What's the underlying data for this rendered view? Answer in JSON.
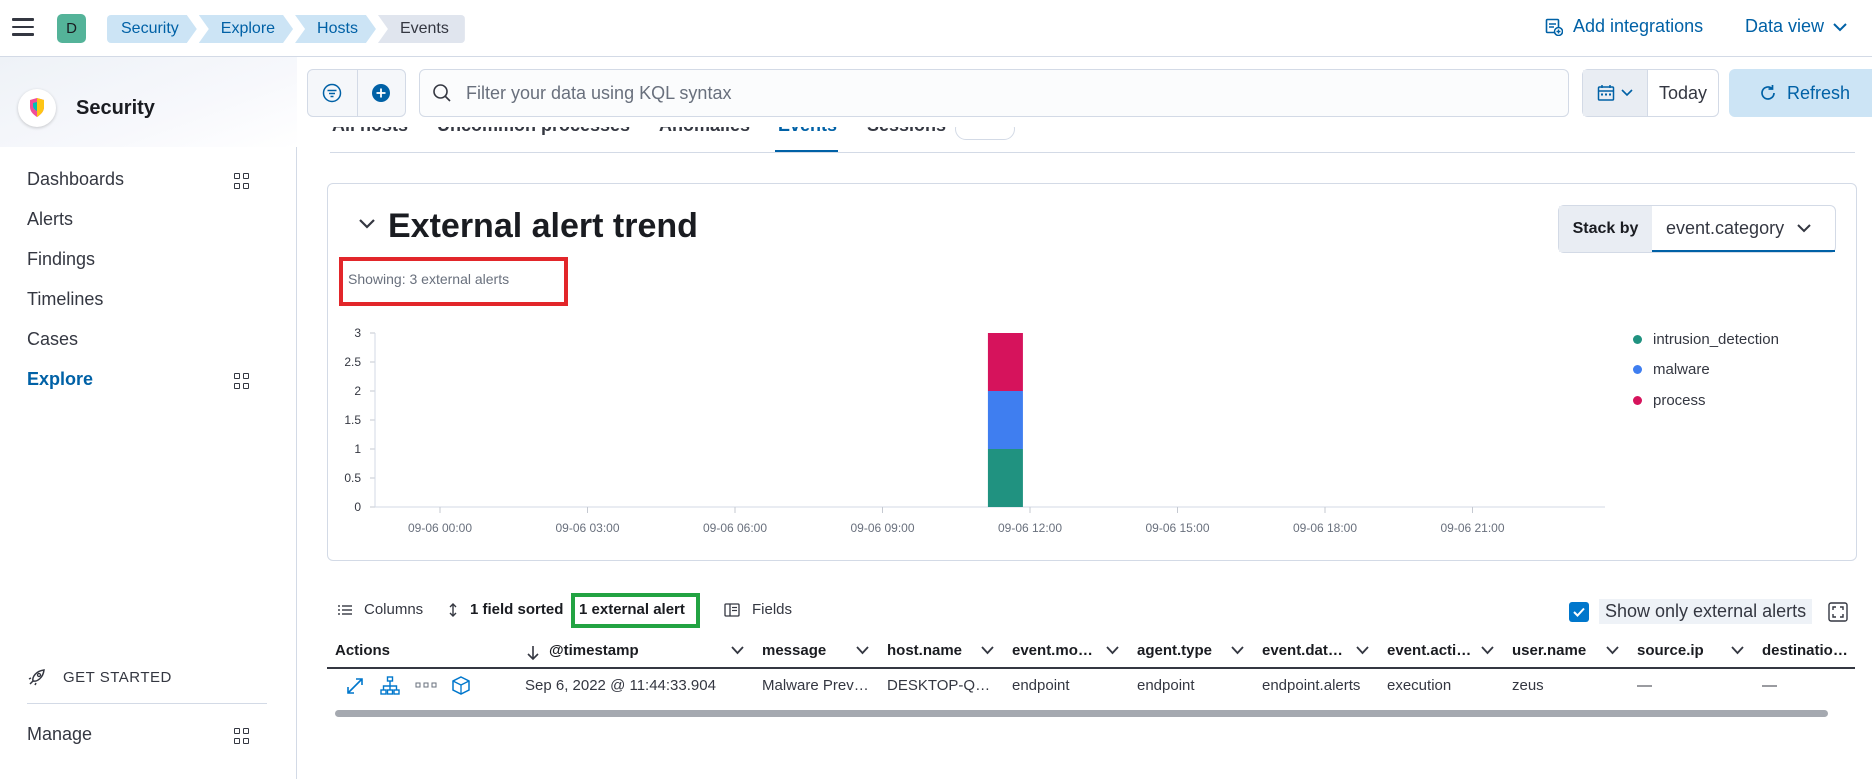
{
  "header": {
    "space_initial": "D",
    "breadcrumbs": [
      "Security",
      "Explore",
      "Hosts",
      "Events"
    ],
    "add_integrations": "Add integrations",
    "data_view": "Data view"
  },
  "sidebar": {
    "title": "Security",
    "items": [
      {
        "label": "Dashboards",
        "has_grid": true
      },
      {
        "label": "Alerts",
        "has_grid": false
      },
      {
        "label": "Findings",
        "has_grid": false
      },
      {
        "label": "Timelines",
        "has_grid": false
      },
      {
        "label": "Cases",
        "has_grid": false
      },
      {
        "label": "Explore",
        "has_grid": true,
        "active": true
      }
    ],
    "get_started": "GET STARTED",
    "manage": "Manage"
  },
  "querybar": {
    "placeholder": "Filter your data using KQL syntax",
    "date": "Today",
    "refresh": "Refresh"
  },
  "tabs": [
    {
      "label": "All hosts"
    },
    {
      "label": "Uncommon processes"
    },
    {
      "label": "Anomalies"
    },
    {
      "label": "Events",
      "active": true
    },
    {
      "label": "Sessions"
    }
  ],
  "panel": {
    "title": "External alert trend",
    "subtitle": "Showing: 3 external alerts",
    "stack_by_label": "Stack by",
    "stack_by_value": "event.category"
  },
  "chart_data": {
    "type": "bar",
    "stacked": true,
    "title": "",
    "xlabel": "",
    "ylabel": "",
    "x_ticks": [
      "09-06 00:00",
      "09-06 03:00",
      "09-06 06:00",
      "09-06 09:00",
      "09-06 12:00",
      "09-06 15:00",
      "09-06 18:00",
      "09-06 21:00"
    ],
    "y_ticks": [
      "0",
      "0.5",
      "1",
      "1.5",
      "2",
      "2.5",
      "3"
    ],
    "ylim": [
      0,
      3
    ],
    "categories": [
      "09-06 11:30"
    ],
    "series": [
      {
        "name": "intrusion_detection",
        "color": "#209280",
        "values": [
          1
        ]
      },
      {
        "name": "malware",
        "color": "#3f7ef0",
        "values": [
          1
        ]
      },
      {
        "name": "process",
        "color": "#d6135c",
        "values": [
          1
        ]
      }
    ],
    "legend_position": "right"
  },
  "table_toolbar": {
    "columns": "Columns",
    "sorted": "1 field sorted",
    "external_alert": "1 external alert",
    "fields": "Fields",
    "show_only": "Show only external alerts"
  },
  "table": {
    "headers": [
      "Actions",
      "@timestamp",
      "message",
      "host.name",
      "event.mo…",
      "agent.type",
      "event.dat…",
      "event.acti…",
      "user.name",
      "source.ip",
      "destinatio…"
    ],
    "rows": [
      [
        "Sep 6, 2022 @ 11:44:33.904",
        "Malware Prev…",
        "DESKTOP-Q…",
        "endpoint",
        "endpoint",
        "endpoint.alerts",
        "execution",
        "zeus",
        "—",
        "—"
      ]
    ]
  }
}
